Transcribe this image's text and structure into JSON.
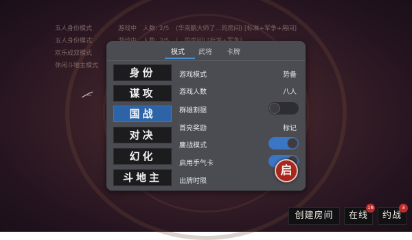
{
  "room_list": [
    {
      "name": "五人身份模式",
      "status": "游戏中",
      "players": "人数: 2/5",
      "desc": "(华南鹏大师了…的房间) [标准+军争+用间]"
    },
    {
      "name": "五人身份模式",
      "status": "游戏中",
      "players": "人数: 3/5",
      "desc": "(…的房间) [标准+军争]"
    },
    {
      "name": "欢乐成双模式",
      "status": "",
      "players": "",
      "desc": ""
    },
    {
      "name": "休闲斗地主模式",
      "status": "",
      "players": "",
      "desc": ""
    }
  ],
  "settings_panel": {
    "tabs": [
      {
        "label": "模式",
        "active": true
      },
      {
        "label": "武将",
        "active": false
      },
      {
        "label": "卡牌",
        "active": false
      }
    ],
    "modes": [
      {
        "label": "身份",
        "selected": false
      },
      {
        "label": "谋攻",
        "selected": false
      },
      {
        "label": "国战",
        "selected": true
      },
      {
        "label": "对决",
        "selected": false
      },
      {
        "label": "幻化",
        "selected": false
      },
      {
        "label": "斗地主",
        "selected": false
      }
    ],
    "rows": [
      {
        "label": "游戏模式",
        "value": "势备"
      },
      {
        "label": "游戏人数",
        "value": "八人"
      },
      {
        "label": "群雄割据",
        "toggle": false
      },
      {
        "label": "首亮奖励",
        "value": "标记"
      },
      {
        "label": "鏖战模式",
        "toggle": true
      },
      {
        "label": "启用手气卡",
        "toggle": true
      },
      {
        "label": "出牌时限",
        "value": ""
      }
    ],
    "start_label": "启"
  },
  "bottom_bar": {
    "create_room": "创建房间",
    "online": "在线",
    "online_badge": "16",
    "invite": "约战",
    "invite_badge": "3"
  },
  "colors": {
    "accent_blue": "#2d64a8",
    "toggle_on": "#3a76c4",
    "start_red": "#a82520",
    "badge_red": "#c02a2a"
  }
}
